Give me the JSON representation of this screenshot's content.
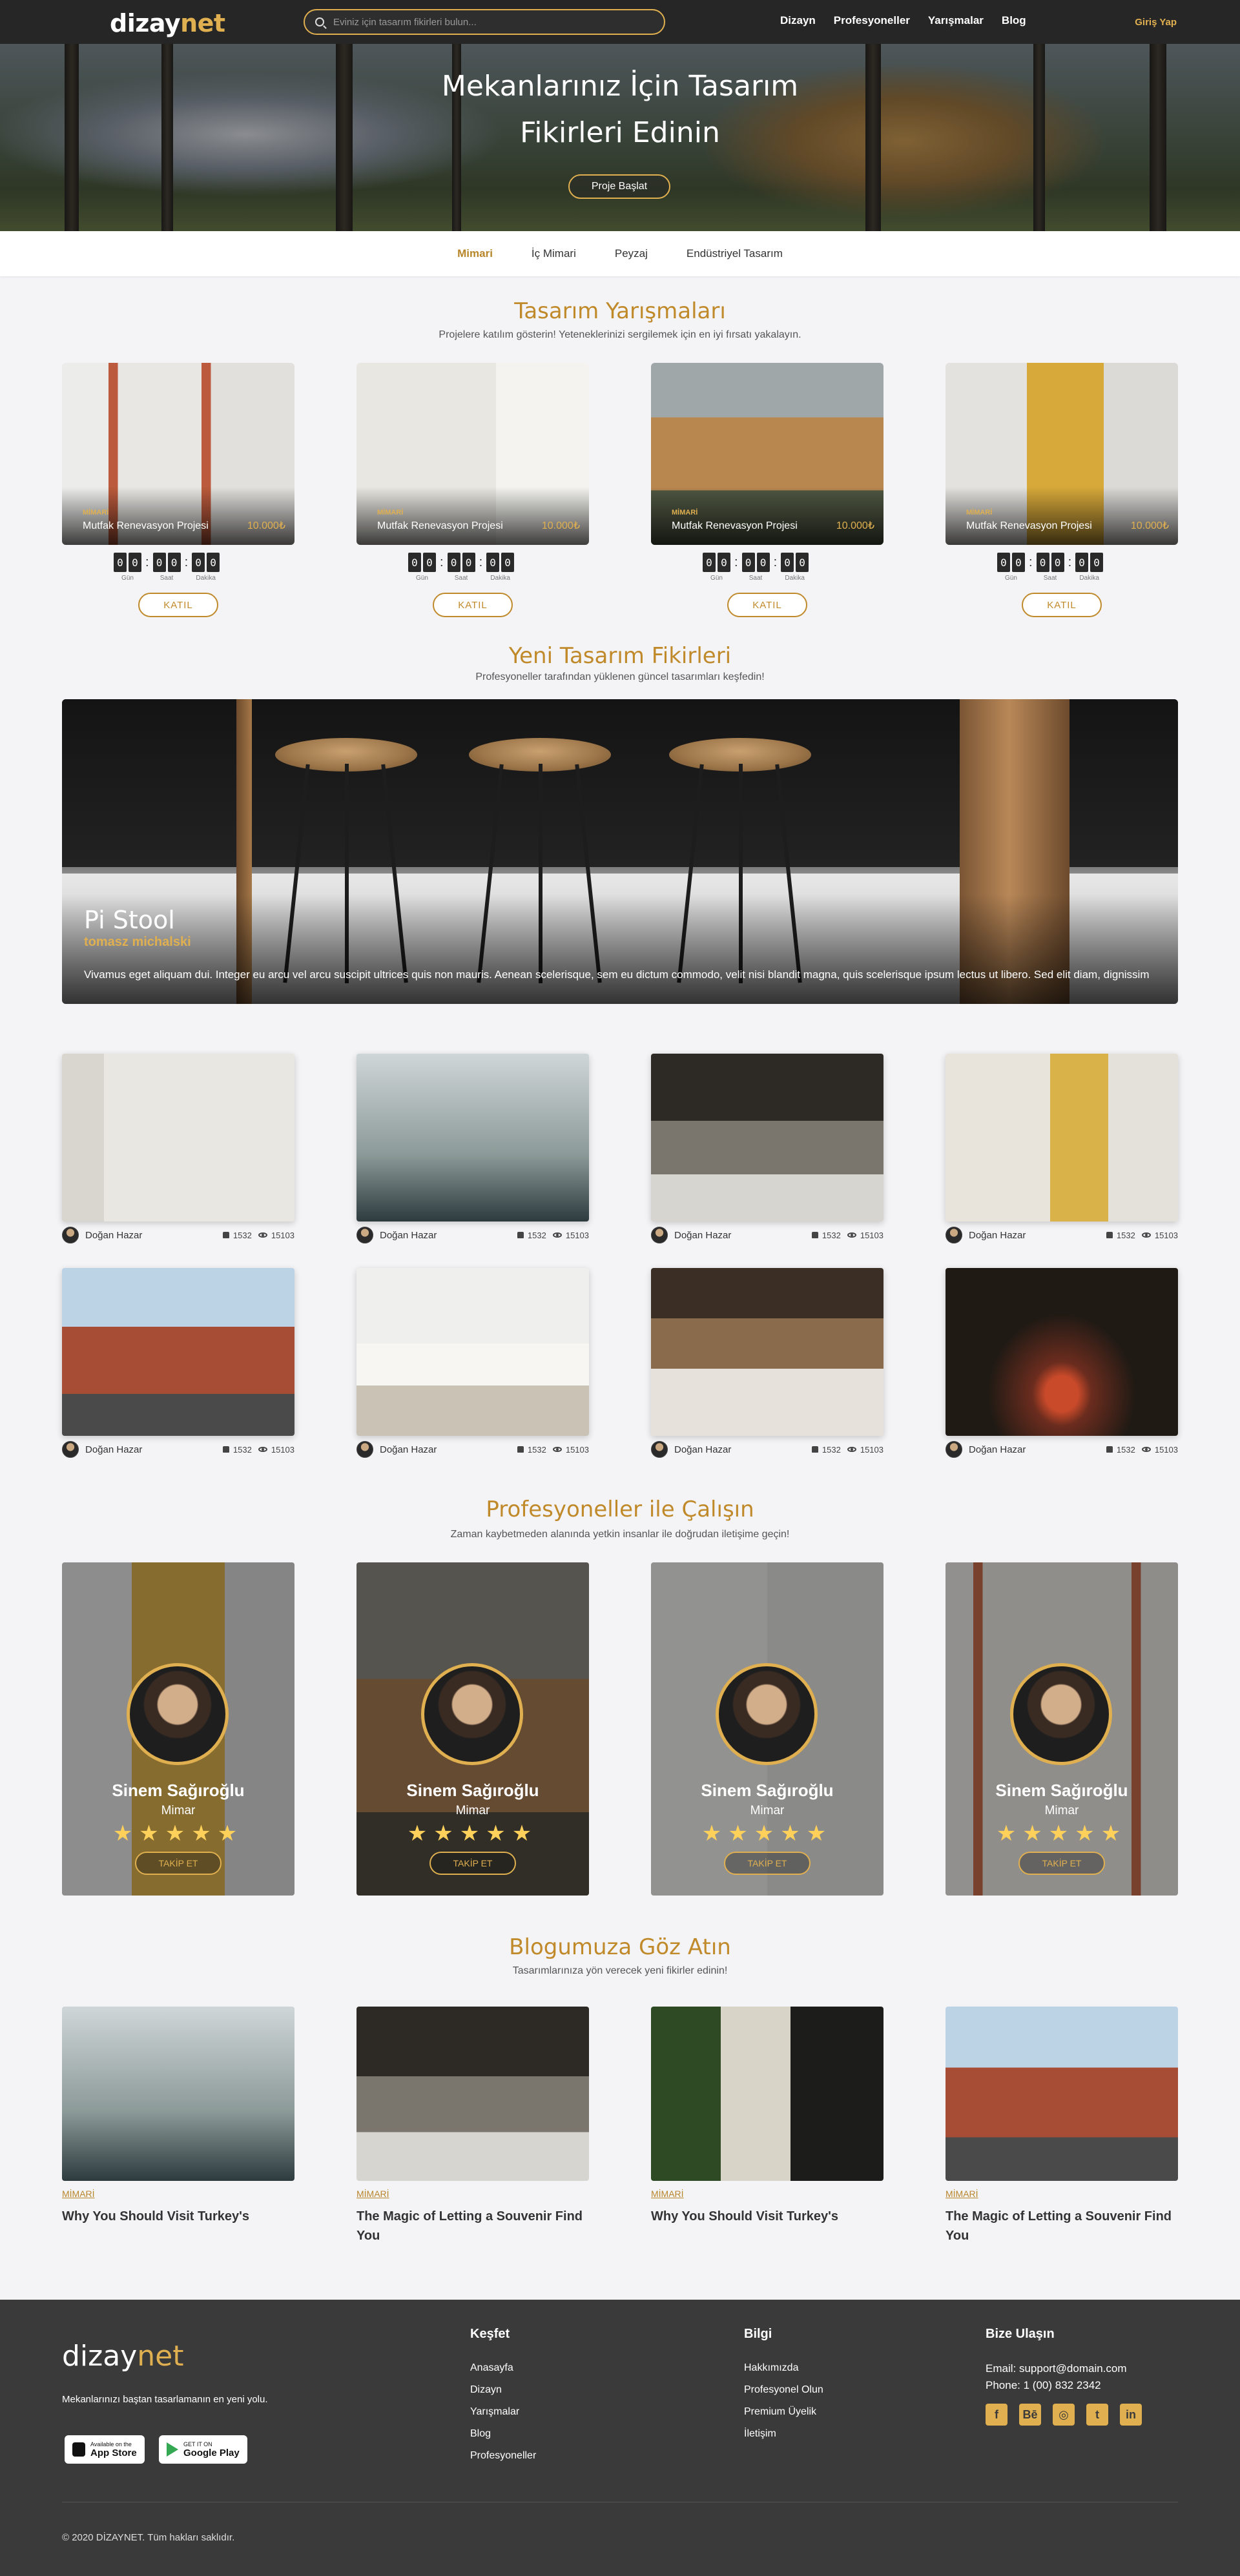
{
  "header": {
    "logo_main": "dizay",
    "logo_accent": "net",
    "search_placeholder": "Eviniz için tasarım fikirleri bulun...",
    "nav": [
      "Dizayn",
      "Profesyoneller",
      "Yarışmalar",
      "Blog"
    ],
    "login": "Giriş Yap"
  },
  "hero": {
    "title_line1": "Mekanlarınız İçin Tasarım",
    "title_line2": "Fikirleri Edinin",
    "cta": "Proje Başlat"
  },
  "categories": [
    {
      "label": "Mimari",
      "active": true
    },
    {
      "label": "İç Mimari",
      "active": false
    },
    {
      "label": "Peyzaj",
      "active": false
    },
    {
      "label": "Endüstriyel Tasarım",
      "active": false
    }
  ],
  "competitions": {
    "title": "Tasarım Yarışmaları",
    "subtitle": "Projelere katılım gösterin! Yeteneklerinizi sergilemek için en iyi fırsatı yakalayın.",
    "timer_labels": [
      "Gün",
      "Saat",
      "Dakika"
    ],
    "join_label": "KATIL",
    "cards": [
      {
        "tag": "MİMARİ",
        "name": "Mutfak Renevasyon Projesi",
        "prize": "10.000₺",
        "digits": [
          "0",
          "0",
          "0",
          "0",
          "0",
          "0"
        ]
      },
      {
        "tag": "MİMARİ",
        "name": "Mutfak Renevasyon Projesi",
        "prize": "10.000₺",
        "digits": [
          "0",
          "0",
          "0",
          "0",
          "0",
          "0"
        ]
      },
      {
        "tag": "MİMARİ",
        "name": "Mutfak Renevasyon Projesi",
        "prize": "10.000₺",
        "digits": [
          "0",
          "0",
          "0",
          "0",
          "0",
          "0"
        ]
      },
      {
        "tag": "MİMARİ",
        "name": "Mutfak Renevasyon Projesi",
        "prize": "10.000₺",
        "digits": [
          "0",
          "0",
          "0",
          "0",
          "0",
          "0"
        ]
      }
    ]
  },
  "ideas": {
    "title": "Yeni Tasarım Fikirleri",
    "subtitle": "Profesyoneller tarafından yüklenen güncel tasarımları keşfedin!",
    "featured": {
      "title": "Pi Stool",
      "author": "tomasz michalski",
      "description": "Vivamus eget aliquam dui. Integer eu arcu vel arcu suscipit ultrices quis non mauris. Aenean scelerisque, sem eu dictum commodo, velit nisi blandit magna, quis scelerisque ipsum lectus ut libero. Sed elit diam, dignissim"
    },
    "gallery": [
      {
        "author": "Doğan Hazar",
        "likes": "1532",
        "views": "15103"
      },
      {
        "author": "Doğan Hazar",
        "likes": "1532",
        "views": "15103"
      },
      {
        "author": "Doğan Hazar",
        "likes": "1532",
        "views": "15103"
      },
      {
        "author": "Doğan Hazar",
        "likes": "1532",
        "views": "15103"
      },
      {
        "author": "Doğan Hazar",
        "likes": "1532",
        "views": "15103"
      },
      {
        "author": "Doğan Hazar",
        "likes": "1532",
        "views": "15103"
      },
      {
        "author": "Doğan Hazar",
        "likes": "1532",
        "views": "15103"
      },
      {
        "author": "Doğan Hazar",
        "likes": "1532",
        "views": "15103"
      }
    ]
  },
  "pros": {
    "title": "Profesyoneller ile Çalışın",
    "subtitle": "Zaman kaybetmeden alanında yetkin insanlar ile doğrudan iletişime geçin!",
    "follow_label": "TAKİP ET",
    "stars": "★★★★★",
    "cards": [
      {
        "name": "Sinem Sağıroğlu",
        "role": "Mimar"
      },
      {
        "name": "Sinem Sağıroğlu",
        "role": "Mimar"
      },
      {
        "name": "Sinem Sağıroğlu",
        "role": "Mimar"
      },
      {
        "name": "Sinem Sağıroğlu",
        "role": "Mimar"
      }
    ]
  },
  "blog": {
    "title": "Blogumuza Göz Atın",
    "subtitle": "Tasarımlarınıza yön verecek yeni fikirler edinin!",
    "posts": [
      {
        "category": "MİMARİ",
        "title": "Why You Should Visit Turkey's"
      },
      {
        "category": "MİMARİ",
        "title": "The Magic of Letting a Souvenir Find You"
      },
      {
        "category": "MİMARİ",
        "title": "Why You Should Visit Turkey's"
      },
      {
        "category": "MİMARİ",
        "title": "The Magic of Letting a Souvenir Find You"
      }
    ]
  },
  "footer": {
    "logo_main": "dizay",
    "logo_accent": "net",
    "tagline": "Mekanlarınızı baştan tasarlamanın en yeni yolu.",
    "appstore_small": "Available on the",
    "appstore": "App Store",
    "googleplay_small": "GET IT ON",
    "googleplay": "Google Play",
    "col1_title": "Keşfet",
    "col1_links": [
      "Anasayfa",
      "Dizayn",
      "Yarışmalar",
      "Blog",
      "Profesyoneller"
    ],
    "col2_title": "Bilgi",
    "col2_links": [
      "Hakkımızda",
      "Profesyonel Olun",
      "Premium Üyelik",
      "İletişim"
    ],
    "col3_title": "Bize Ulaşın",
    "email": "Email: support@domain.com",
    "phone": "Phone: 1 (00) 832 2342",
    "social": [
      "facebook-icon",
      "behance-icon",
      "instagram-icon",
      "twitter-icon",
      "linkedin-icon"
    ],
    "copyright": "© 2020 DİZAYNET. Tüm hakları saklıdır."
  }
}
